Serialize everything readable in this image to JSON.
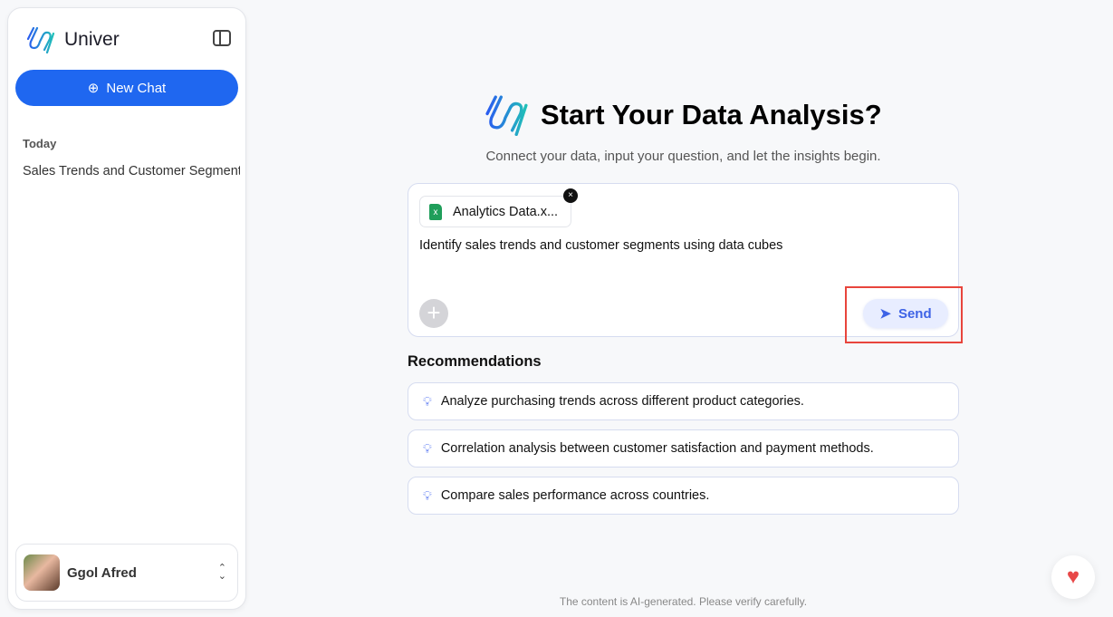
{
  "sidebar": {
    "brand": "Univer",
    "new_chat": "New Chat",
    "section": "Today",
    "history": [
      "Sales Trends and Customer Segments"
    ],
    "user": "Ggol Afred"
  },
  "main": {
    "title": "Start Your Data Analysis?",
    "subtitle": "Connect your data, input your question, and let the insights begin.",
    "attachment": "Analytics Data.x...",
    "prompt": "Identify sales trends and customer segments using data cubes",
    "send": "Send",
    "recommendations_title": "Recommendations",
    "recommendations": [
      "Analyze purchasing trends across different product categories.",
      "Correlation analysis between customer satisfaction and payment methods.",
      "Compare sales performance across countries."
    ],
    "footer": "The content is AI-generated. Please verify carefully."
  },
  "colors": {
    "accent": "#1f67f0",
    "send": "#3e63e6",
    "highlight": "#e8453c",
    "heart": "#e84848"
  }
}
